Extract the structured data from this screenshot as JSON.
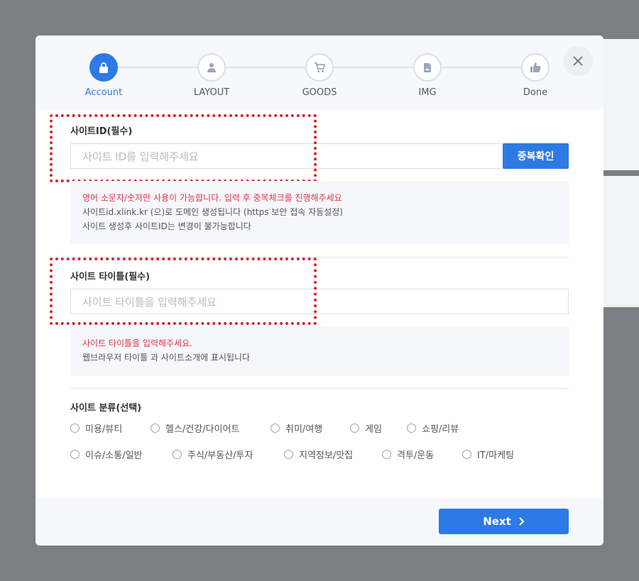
{
  "steps": [
    {
      "label": "Account",
      "icon": "lock-icon",
      "active": true
    },
    {
      "label": "LAYOUT",
      "icon": "user-icon",
      "active": false
    },
    {
      "label": "GOODS",
      "icon": "cart-icon",
      "active": false
    },
    {
      "label": "IMG",
      "icon": "image-file-icon",
      "active": false
    },
    {
      "label": "Done",
      "icon": "thumbs-up-icon",
      "active": false
    }
  ],
  "site_id": {
    "title": "사이트ID(필수)",
    "placeholder": "사이트 ID를 입력해주세요",
    "button": "중복확인",
    "notes": {
      "warning": "영어 소문자/숫자만 사용이 가능합니다. 입력 후 중복체크를 진행해주세요",
      "line1": "사이트id.xlink.kr (으)로 도메인 생성됩니다 (https 보안 접속 자동설정)",
      "line2": "사이트 생성후 사이트ID는 변경이 불가능합니다"
    }
  },
  "site_title": {
    "title": "사이트 타이틀(필수)",
    "placeholder": "사이트 타이틀을 입력해주세요",
    "notes": {
      "warning": "사이트 타이틀을 입력해주세요.",
      "line1": "웹브라우저 타이틀 과 사이트소개에 표시됩니다"
    }
  },
  "category": {
    "title": "사이트 분류(선택)",
    "row1": [
      "미용/뷰티",
      "헬스/건강/다이어트",
      "취미/여행",
      "게임",
      "쇼핑/리뷰"
    ],
    "row2": [
      "이슈/소통/일반",
      "주식/부동산/투자",
      "지역정보/맛집",
      "격투/운동",
      "IT/마케팅"
    ]
  },
  "footer": {
    "next_label": "Next"
  },
  "colors": {
    "accent": "#2d7ae4",
    "warning": "#e5364a",
    "highlight": "#d8232a"
  }
}
